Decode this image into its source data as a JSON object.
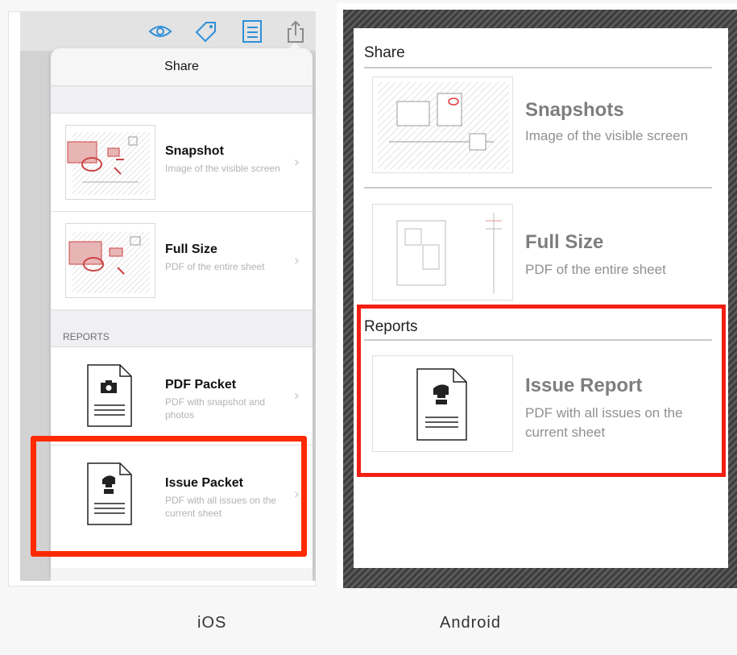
{
  "ios": {
    "caption": "iOS",
    "toolbar_icons": [
      "eye-icon",
      "tag-icon",
      "list-icon",
      "share-icon"
    ],
    "popover_title": "Share",
    "rows": [
      {
        "title": "Snapshot",
        "subtitle": "Image of the visible screen"
      },
      {
        "title": "Full Size",
        "subtitle": "PDF of the entire sheet"
      }
    ],
    "reports_header": "REPORTS",
    "report_rows": [
      {
        "title": "PDF Packet",
        "subtitle": "PDF with snapshot and photos"
      },
      {
        "title": "Issue Packet",
        "subtitle": "PDF with all issues on the current sheet"
      }
    ],
    "chevron": "›",
    "highlight_color": "#ff2a00"
  },
  "android": {
    "caption": "Android",
    "share_label": "Share",
    "items": [
      {
        "title": "Snapshots",
        "subtitle": "Image of the visible screen"
      },
      {
        "title": "Full Size",
        "subtitle": "PDF of the entire sheet"
      }
    ],
    "reports_label": "Reports",
    "report_item": {
      "title": "Issue Report",
      "subtitle": "PDF with all issues on the current sheet"
    },
    "highlight_color": "#f31f13"
  }
}
